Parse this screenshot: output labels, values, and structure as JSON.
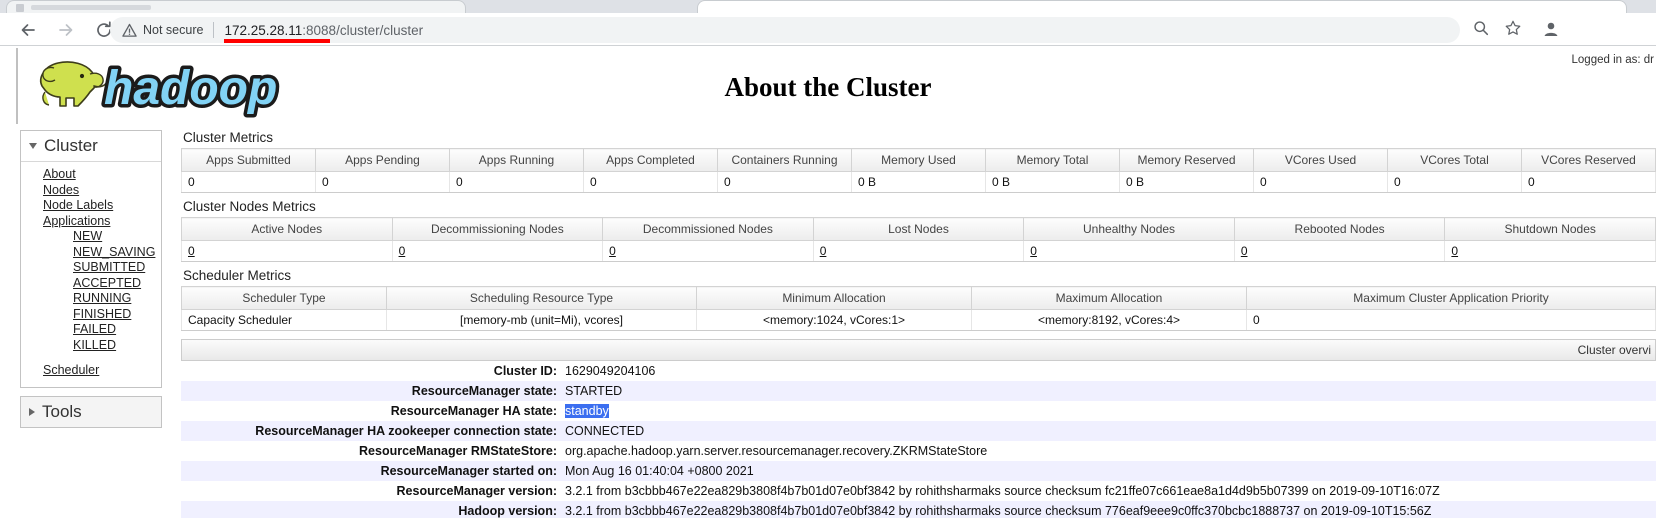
{
  "browser": {
    "security_label": "Not secure",
    "url_host": "172.25.28.11",
    "url_rest": ":8088/cluster/cluster",
    "back_icon": "back-arrow-icon",
    "forward_icon": "forward-arrow-icon",
    "reload_icon": "reload-icon",
    "warning_icon": "warning-triangle-icon",
    "zoom_icon": "zoom-magnifier-icon",
    "bookmark_icon": "bookmark-star-icon",
    "profile_icon": "profile-avatar-icon"
  },
  "header": {
    "title": "About the Cluster",
    "logo_alt": "hadoop",
    "logged_in_as": "Logged in as: dr"
  },
  "sidebar": {
    "cluster_panel": {
      "title": "Cluster",
      "expanded": true,
      "items": [
        {
          "label": "About"
        },
        {
          "label": "Nodes"
        },
        {
          "label": "Node Labels"
        },
        {
          "label": "Applications"
        }
      ],
      "application_states": [
        {
          "label": "NEW"
        },
        {
          "label": "NEW_SAVING"
        },
        {
          "label": "SUBMITTED"
        },
        {
          "label": "ACCEPTED"
        },
        {
          "label": "RUNNING"
        },
        {
          "label": "FINISHED"
        },
        {
          "label": "FAILED"
        },
        {
          "label": "KILLED"
        }
      ],
      "scheduler_label": "Scheduler"
    },
    "tools_panel": {
      "title": "Tools",
      "expanded": false
    }
  },
  "main": {
    "cluster_metrics": {
      "title": "Cluster Metrics",
      "columns": [
        "Apps Submitted",
        "Apps Pending",
        "Apps Running",
        "Apps Completed",
        "Containers Running",
        "Memory Used",
        "Memory Total",
        "Memory Reserved",
        "VCores Used",
        "VCores Total",
        "VCores Reserved"
      ],
      "values": [
        "0",
        "0",
        "0",
        "0",
        "0",
        "0 B",
        "0 B",
        "0 B",
        "0",
        "0",
        "0"
      ]
    },
    "cluster_nodes_metrics": {
      "title": "Cluster Nodes Metrics",
      "columns": [
        "Active Nodes",
        "Decommissioning Nodes",
        "Decommissioned Nodes",
        "Lost Nodes",
        "Unhealthy Nodes",
        "Rebooted Nodes",
        "Shutdown Nodes"
      ],
      "values": [
        "0",
        "0",
        "0",
        "0",
        "0",
        "0",
        "0"
      ]
    },
    "scheduler_metrics": {
      "title": "Scheduler Metrics",
      "columns": [
        "Scheduler Type",
        "Scheduling Resource Type",
        "Minimum Allocation",
        "Maximum Allocation",
        "Maximum Cluster Application Priority"
      ],
      "values": [
        "Capacity Scheduler",
        "[memory-mb (unit=Mi), vcores]",
        "<memory:1024, vCores:1>",
        "<memory:8192, vCores:4>",
        "0"
      ]
    },
    "about_table": {
      "caption": "Cluster overvi",
      "rows": [
        {
          "key": "Cluster ID:",
          "value": "1629049204106",
          "selected": false
        },
        {
          "key": "ResourceManager state:",
          "value": "STARTED",
          "selected": false
        },
        {
          "key": "ResourceManager HA state:",
          "value": "standby",
          "selected": true
        },
        {
          "key": "ResourceManager HA zookeeper connection state:",
          "value": "CONNECTED",
          "selected": false
        },
        {
          "key": "ResourceManager RMStateStore:",
          "value": "org.apache.hadoop.yarn.server.resourcemanager.recovery.ZKRMStateStore",
          "selected": false
        },
        {
          "key": "ResourceManager started on:",
          "value": "Mon Aug 16 01:40:04 +0800 2021",
          "selected": false
        },
        {
          "key": "ResourceManager version:",
          "value": "3.2.1 from b3cbbb467e22ea829b3808f4b7b01d07e0bf3842 by rohithsharmaks source checksum fc21ffe07c661eae8a1d4d9b5b07399 on 2019-09-10T16:07Z",
          "selected": false
        },
        {
          "key": "Hadoop version:",
          "value": "3.2.1 from b3cbbb467e22ea829b3808f4b7b01d07e0bf3842 by rohithsharmaks source checksum 776eaf9eee9c0ffc370bcbc1888737 on 2019-09-10T15:56Z",
          "selected": false
        }
      ]
    }
  },
  "colors": {
    "accent_blue": "#3b6ef0",
    "url_underline_red": "#ff0000",
    "row_alt": "#f0f0ff",
    "logo_blue": "#7ed2f7",
    "logo_green": "#cce05a"
  }
}
